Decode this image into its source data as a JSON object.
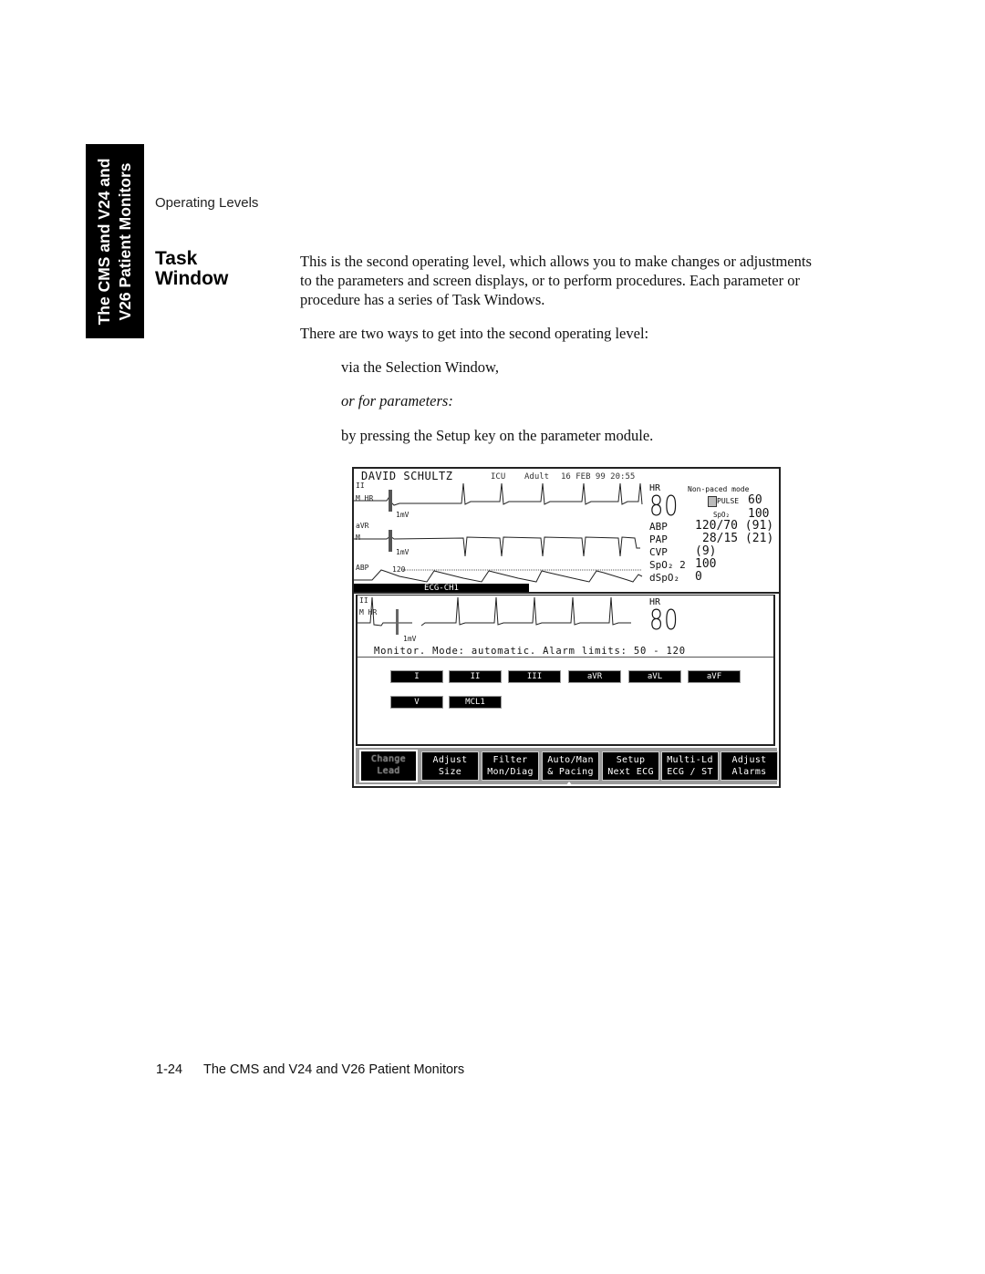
{
  "side_tab": {
    "line1": "The CMS and V24 and",
    "line2": "V26 Patient Monitors"
  },
  "section_label": "Operating Levels",
  "heading": {
    "line1": "Task",
    "line2": "Window"
  },
  "body": {
    "paragraph1": "This is the second operating level, which allows you to make changes or adjustments to the parameters and screen displays, or to perform procedures. Each parameter or procedure has a series of Task Windows.",
    "paragraph2": "There are two ways to get into the second operating level:",
    "option1": "via the Selection Window,",
    "connector": "or for parameters:",
    "option2": "by pressing the Setup key on the parameter module."
  },
  "monitor": {
    "header": {
      "patient_name": "DAVID SCHULTZ",
      "unit": "ICU",
      "patient_type": "Adult",
      "datetime": "16 FEB 99 20:55"
    },
    "waves": [
      {
        "lead": "II",
        "sub_label": "M HR",
        "scale": "1mV"
      },
      {
        "lead": "aVR",
        "sub_label": "M",
        "scale": "1mV"
      },
      {
        "lead": "ABP",
        "scale_value": "120"
      }
    ],
    "params": {
      "hr_label": "HR",
      "hr_value": "80",
      "pacing_mode": "Non-paced mode",
      "pulse_label": "PULSE",
      "pulse_value": "60",
      "pulse_source_label": "SpO₂",
      "pulse_source_value": "100",
      "rows": [
        {
          "label": "ABP",
          "value": "120/70 (91)"
        },
        {
          "label": "PAP",
          "value": "28/15 (21)"
        },
        {
          "label": "CVP",
          "value": "(9)"
        },
        {
          "label": "SpO₂ 2",
          "value": "100"
        },
        {
          "label": "dSpO₂",
          "value": "0"
        }
      ]
    },
    "task_window": {
      "tab_title": "ECG-CH1",
      "lead": "II",
      "sub_label": "M HR",
      "scale": "1mV",
      "hr_label": "HR",
      "hr_value": "80",
      "status_line": "Monitor.  Mode: automatic.  Alarm limits:  50 - 120",
      "lead_buttons": [
        "I",
        "II",
        "III",
        "aVR",
        "aVL",
        "aVF",
        "V",
        "MCL1"
      ]
    },
    "softkeys": [
      {
        "line1": "Change",
        "line2": "Lead",
        "active": true
      },
      {
        "line1": "Adjust",
        "line2": "Size"
      },
      {
        "line1": "Filter",
        "line2": "Mon/Diag"
      },
      {
        "line1": "Auto/Man",
        "line2": "& Pacing"
      },
      {
        "line1": "Setup",
        "line2": "Next ECG"
      },
      {
        "line1": "Multi-Ld",
        "line2": "ECG / ST"
      },
      {
        "line1": "Adjust",
        "line2": "Alarms"
      }
    ]
  },
  "footer": {
    "page_number": "1-24",
    "title": "The CMS and V24 and V26 Patient Monitors"
  }
}
